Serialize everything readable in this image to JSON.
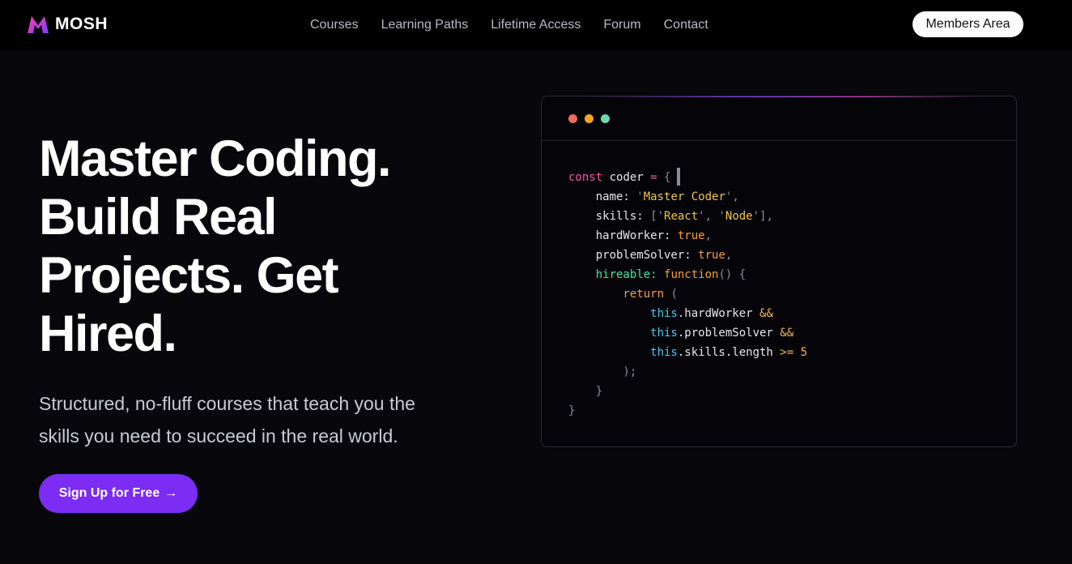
{
  "brand": {
    "name": "MOSH"
  },
  "nav": {
    "links": [
      "Courses",
      "Learning Paths",
      "Lifetime Access",
      "Forum",
      "Contact"
    ],
    "members_label": "Members Area"
  },
  "hero": {
    "title_lines": [
      "Master Coding.",
      "Build Real",
      "Projects. Get",
      "Hired."
    ],
    "subtitle_lines": [
      "Structured, no-fluff courses that teach you the",
      "skills you need to succeed in the real world."
    ],
    "cta_label": "Sign Up for Free",
    "cta_icon": "arrow-right-icon"
  },
  "code_card": {
    "window_dots": [
      "#ee6b5f",
      "#f5a524",
      "#6fd6b0"
    ],
    "lines": [
      [
        {
          "t": "const",
          "c": "kw"
        },
        {
          "t": " coder ",
          "c": ""
        },
        {
          "t": "=",
          "c": "op"
        },
        {
          "t": " {",
          "c": "br"
        },
        {
          "t": "",
          "c": "caret"
        }
      ],
      [
        {
          "t": "    name: ",
          "c": ""
        },
        {
          "t": "'",
          "c": "br"
        },
        {
          "t": "Master Coder",
          "c": "str"
        },
        {
          "t": "'",
          "c": "br"
        },
        {
          "t": ",",
          "c": "br"
        }
      ],
      [
        {
          "t": "    skills: ",
          "c": ""
        },
        {
          "t": "['",
          "c": "br"
        },
        {
          "t": "React",
          "c": "str"
        },
        {
          "t": "', '",
          "c": "br"
        },
        {
          "t": "Node",
          "c": "str"
        },
        {
          "t": "'],",
          "c": "br"
        }
      ],
      [
        {
          "t": "    hardWorker: ",
          "c": ""
        },
        {
          "t": "true",
          "c": "bool"
        },
        {
          "t": ",",
          "c": "br"
        }
      ],
      [
        {
          "t": "    problemSolver: ",
          "c": ""
        },
        {
          "t": "true",
          "c": "bool"
        },
        {
          "t": ",",
          "c": "br"
        }
      ],
      [
        {
          "t": "    hireable: ",
          "c": "fnname"
        },
        {
          "t": "function",
          "c": "fn"
        },
        {
          "t": "() {",
          "c": "br"
        }
      ],
      [
        {
          "t": "        return",
          "c": "fn"
        },
        {
          "t": " (",
          "c": "br"
        }
      ],
      [
        {
          "t": "            this",
          "c": "this"
        },
        {
          "t": ".hardWorker ",
          "c": ""
        },
        {
          "t": "&&",
          "c": "andop"
        }
      ],
      [
        {
          "t": "            this",
          "c": "this"
        },
        {
          "t": ".problemSolver ",
          "c": ""
        },
        {
          "t": "&&",
          "c": "andop"
        }
      ],
      [
        {
          "t": "            this",
          "c": "this"
        },
        {
          "t": ".skills.length ",
          "c": ""
        },
        {
          "t": ">=",
          "c": "andop"
        },
        {
          "t": " 5",
          "c": "num"
        }
      ],
      [
        {
          "t": "        );",
          "c": "br"
        }
      ],
      [
        {
          "t": "    }",
          "c": "br"
        }
      ],
      [
        {
          "t": "}",
          "c": "br"
        }
      ]
    ]
  }
}
